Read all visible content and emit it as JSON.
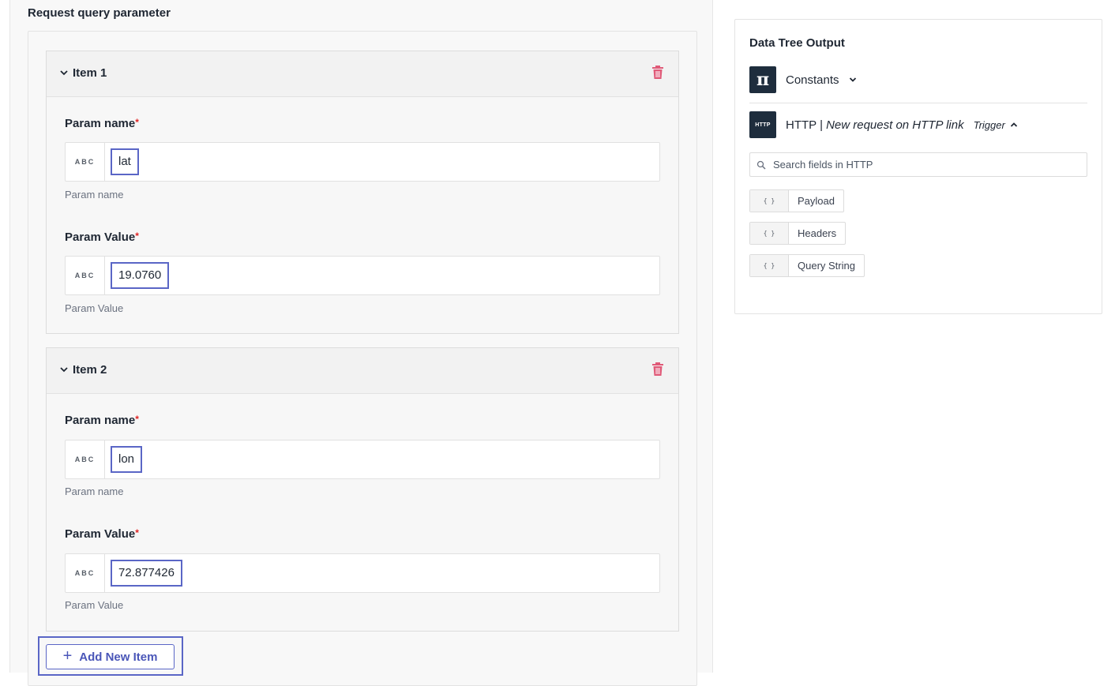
{
  "section": {
    "title": "Request query parameter"
  },
  "items": [
    {
      "title": "Item 1",
      "fields": [
        {
          "label": "Param name",
          "required_mark": "*",
          "type_badge": "ABC",
          "value": "lat",
          "helper": "Param name"
        },
        {
          "label": "Param Value",
          "required_mark": "*",
          "type_badge": "ABC",
          "value": "19.0760",
          "helper": "Param Value"
        }
      ]
    },
    {
      "title": "Item 2",
      "fields": [
        {
          "label": "Param name",
          "required_mark": "*",
          "type_badge": "ABC",
          "value": "lon",
          "helper": "Param name"
        },
        {
          "label": "Param Value",
          "required_mark": "*",
          "type_badge": "ABC",
          "value": "72.877426",
          "helper": "Param Value"
        }
      ]
    }
  ],
  "add_button": {
    "label": "Add New Item",
    "icon": "+"
  },
  "data_tree": {
    "title": "Data Tree Output",
    "constants": {
      "label": "Constants",
      "icon": "π"
    },
    "http": {
      "icon": "HTTP",
      "name": "HTTP",
      "separator": "|",
      "event": "New request on HTTP link",
      "badge": "Trigger"
    },
    "search": {
      "placeholder": "Search fields in HTTP"
    },
    "fields": [
      {
        "icon": "{ }",
        "label": "Payload"
      },
      {
        "icon": "{ }",
        "label": "Headers"
      },
      {
        "icon": "{ }",
        "label": "Query String"
      }
    ]
  },
  "colors": {
    "accent": "#5a66c6",
    "required": "#e02424",
    "trash": "#e05a78",
    "icon_bg": "#1e2d3d"
  }
}
